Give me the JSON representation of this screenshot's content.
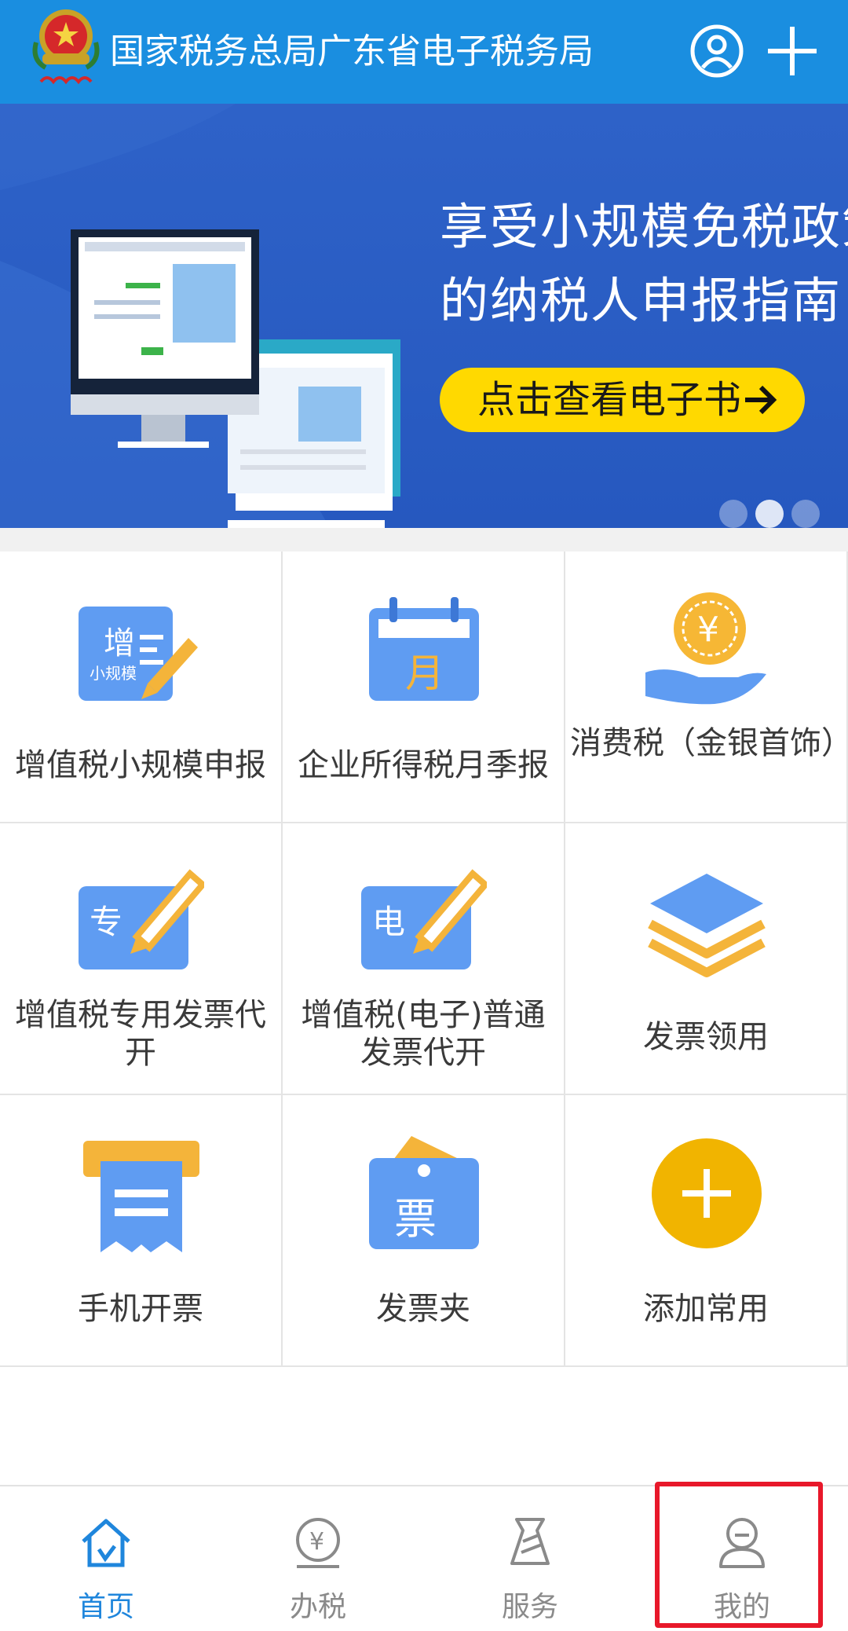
{
  "header": {
    "title": "国家税务总局广东省电子税务局",
    "logo_icon": "tax-emblem-icon",
    "user_icon": "user-circle-icon",
    "add_icon": "plus-icon",
    "bg_color": "#1a8ee0"
  },
  "banner": {
    "line1": "享受小规模免税政策",
    "line2": "的纳税人申报指南",
    "button_label": "点击查看电子书",
    "button_color": "#ffd900",
    "slide_count": 3,
    "active_slide": 2
  },
  "grid": {
    "items": [
      {
        "label": "增值税小规模申报",
        "icon": "vat-small-scale-icon",
        "icon_text_main": "增",
        "icon_text_sub": "小规模"
      },
      {
        "label": "企业所得税月季报",
        "icon": "calendar-month-icon",
        "icon_text_main": "月"
      },
      {
        "label": "消费税（金银首饰）",
        "icon": "coin-hand-icon",
        "icon_text_main": "¥"
      },
      {
        "label": "增值税专用发票代开",
        "icon": "special-invoice-icon",
        "icon_text_main": "专"
      },
      {
        "label": "增值税(电子)普通发票代开",
        "icon": "electronic-invoice-icon",
        "icon_text_main": "电"
      },
      {
        "label": "发票领用",
        "icon": "layers-icon"
      },
      {
        "label": "手机开票",
        "icon": "receipt-printer-icon"
      },
      {
        "label": "发票夹",
        "icon": "invoice-folder-icon",
        "icon_text_main": "票"
      },
      {
        "label": "添加常用",
        "icon": "add-circle-icon"
      }
    ]
  },
  "bottom_nav": {
    "items": [
      {
        "label": "首页",
        "icon": "home-icon",
        "active": true
      },
      {
        "label": "办税",
        "icon": "tax-coin-icon",
        "active": false
      },
      {
        "label": "服务",
        "icon": "service-tie-icon",
        "active": false
      },
      {
        "label": "我的",
        "icon": "profile-icon",
        "active": false
      }
    ],
    "active_color": "#1f86dc",
    "inactive_color": "#8a8a8a"
  },
  "annotation": {
    "highlight_color": "#e8182a",
    "highlighted_item": "我的"
  }
}
